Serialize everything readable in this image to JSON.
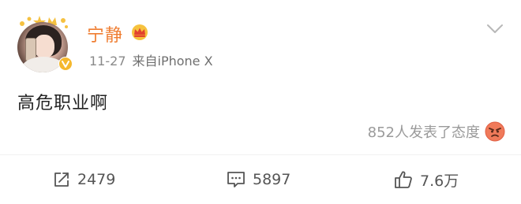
{
  "post": {
    "user": {
      "name": "宁静",
      "avatar_icon": "avatar-photo",
      "verified_icon": "verified-v-icon",
      "vip_icon": "crown-vip-icon"
    },
    "meta": {
      "date": "11-27",
      "source": "来自iPhone X"
    },
    "text": "高危职业啊",
    "reaction": {
      "label": "852人发表了态度",
      "icon": "angry-face-icon"
    },
    "actions": {
      "repost": "2479",
      "comment": "5897",
      "like": "7.6万"
    },
    "colors": {
      "username": "#ef7d31",
      "verified": "#f5b82e",
      "meta": "#8a8a8a"
    }
  }
}
